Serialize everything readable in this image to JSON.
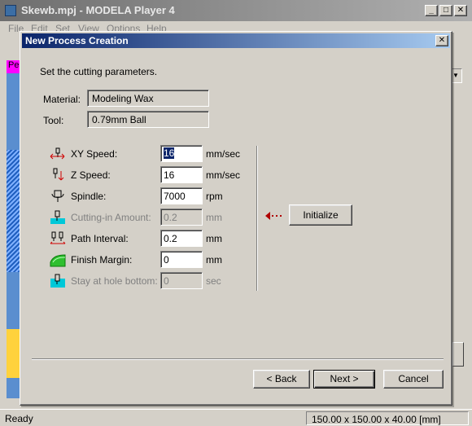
{
  "main_window": {
    "title": "Skewb.mpj - MODELA Player 4",
    "menu": [
      "File",
      "Edit",
      "Set",
      "View",
      "Options",
      "Help"
    ],
    "left_tab_label": "Pe",
    "status_ready": "Ready",
    "status_size": "150.00 x 150.00 x 40.00 [mm]",
    "controls": {
      "minimize": "_",
      "maximize": "□",
      "close": "✕"
    }
  },
  "dialog": {
    "title": "New Process Creation",
    "close_glyph": "✕",
    "instruction": "Set the cutting parameters.",
    "material_label": "Material:",
    "material_value": "Modeling Wax",
    "tool_label": "Tool:",
    "tool_value": "0.79mm Ball",
    "params": {
      "xy_speed": {
        "label": "XY Speed:",
        "value": "16",
        "unit": "mm/sec",
        "enabled": true,
        "icon": "xy-speed-icon"
      },
      "z_speed": {
        "label": "Z Speed:",
        "value": "16",
        "unit": "mm/sec",
        "enabled": true,
        "icon": "z-speed-icon"
      },
      "spindle": {
        "label": "Spindle:",
        "value": "7000",
        "unit": "rpm",
        "enabled": true,
        "icon": "spindle-icon"
      },
      "cutting_in": {
        "label": "Cutting-in Amount:",
        "value": "0.2",
        "unit": "mm",
        "enabled": false,
        "icon": "cutting-in-icon"
      },
      "path_interval": {
        "label": "Path Interval:",
        "value": "0.2",
        "unit": "mm",
        "enabled": true,
        "icon": "path-interval-icon"
      },
      "finish_margin": {
        "label": "Finish Margin:",
        "value": "0",
        "unit": "mm",
        "enabled": true,
        "icon": "finish-margin-icon"
      },
      "stay_hole": {
        "label": "Stay at hole bottom:",
        "value": "0",
        "unit": "sec",
        "enabled": false,
        "icon": "stay-hole-icon"
      }
    },
    "initialize_label": "Initialize",
    "back_label": "< Back",
    "next_label": "Next >",
    "cancel_label": "Cancel"
  },
  "colors": {
    "dialog_title_start": "#0a246a",
    "dialog_title_end": "#a6caf0",
    "face": "#d4d0c8",
    "selection": "#0a246a"
  }
}
